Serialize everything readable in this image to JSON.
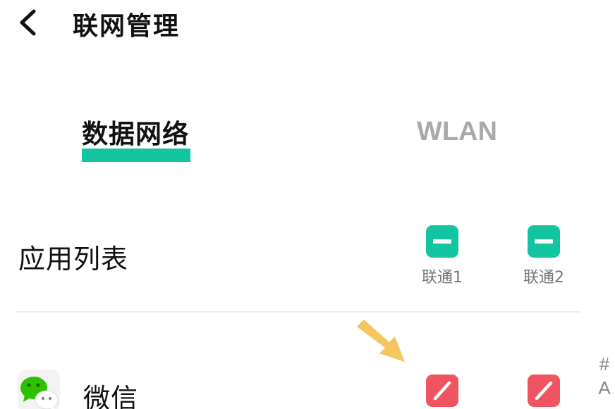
{
  "header": {
    "back_icon": "chevron-left-icon",
    "title": "联网管理"
  },
  "tabs": [
    {
      "label": "数据网络",
      "selected": true
    },
    {
      "label": "WLAN",
      "selected": false
    }
  ],
  "list_header": {
    "title": "应用列表",
    "sims": [
      {
        "label": "联通1",
        "state": "partial",
        "icon": "minus-icon"
      },
      {
        "label": "联通2",
        "state": "partial",
        "icon": "minus-icon"
      }
    ]
  },
  "apps": [
    {
      "name": "微信",
      "icon": "wechat-icon",
      "sim1_state": "blocked",
      "sim2_state": "blocked",
      "toggle_icon": "slash-icon"
    }
  ],
  "annotation": {
    "arrow_icon": "arrow-down-right-icon"
  },
  "index_bar": [
    "#",
    "A"
  ],
  "colors": {
    "accent": "#12c4a0",
    "blocked": "#f15461",
    "arrow": "#f4c660",
    "inactive_tab": "#a9a9a9"
  }
}
